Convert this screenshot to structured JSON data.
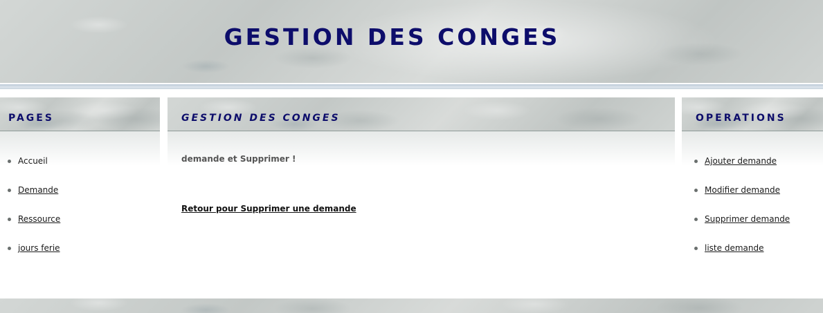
{
  "header": {
    "title": "GESTION DES CONGES"
  },
  "sidebar_left": {
    "heading": "PAGES",
    "items": [
      {
        "label": "Accueil"
      },
      {
        "label": "Demande"
      },
      {
        "label": "Ressource"
      },
      {
        "label": "jours ferie"
      }
    ]
  },
  "main": {
    "heading": "GESTION DES CONGES",
    "message": "demande et Supprimer !",
    "back_link": "Retour pour Supprimer une demande"
  },
  "sidebar_right": {
    "heading": "OPERATIONS",
    "items": [
      {
        "label": "Ajouter demande"
      },
      {
        "label": "Modifier demande"
      },
      {
        "label": "Supprimer demande"
      },
      {
        "label": "liste demande"
      }
    ]
  }
}
